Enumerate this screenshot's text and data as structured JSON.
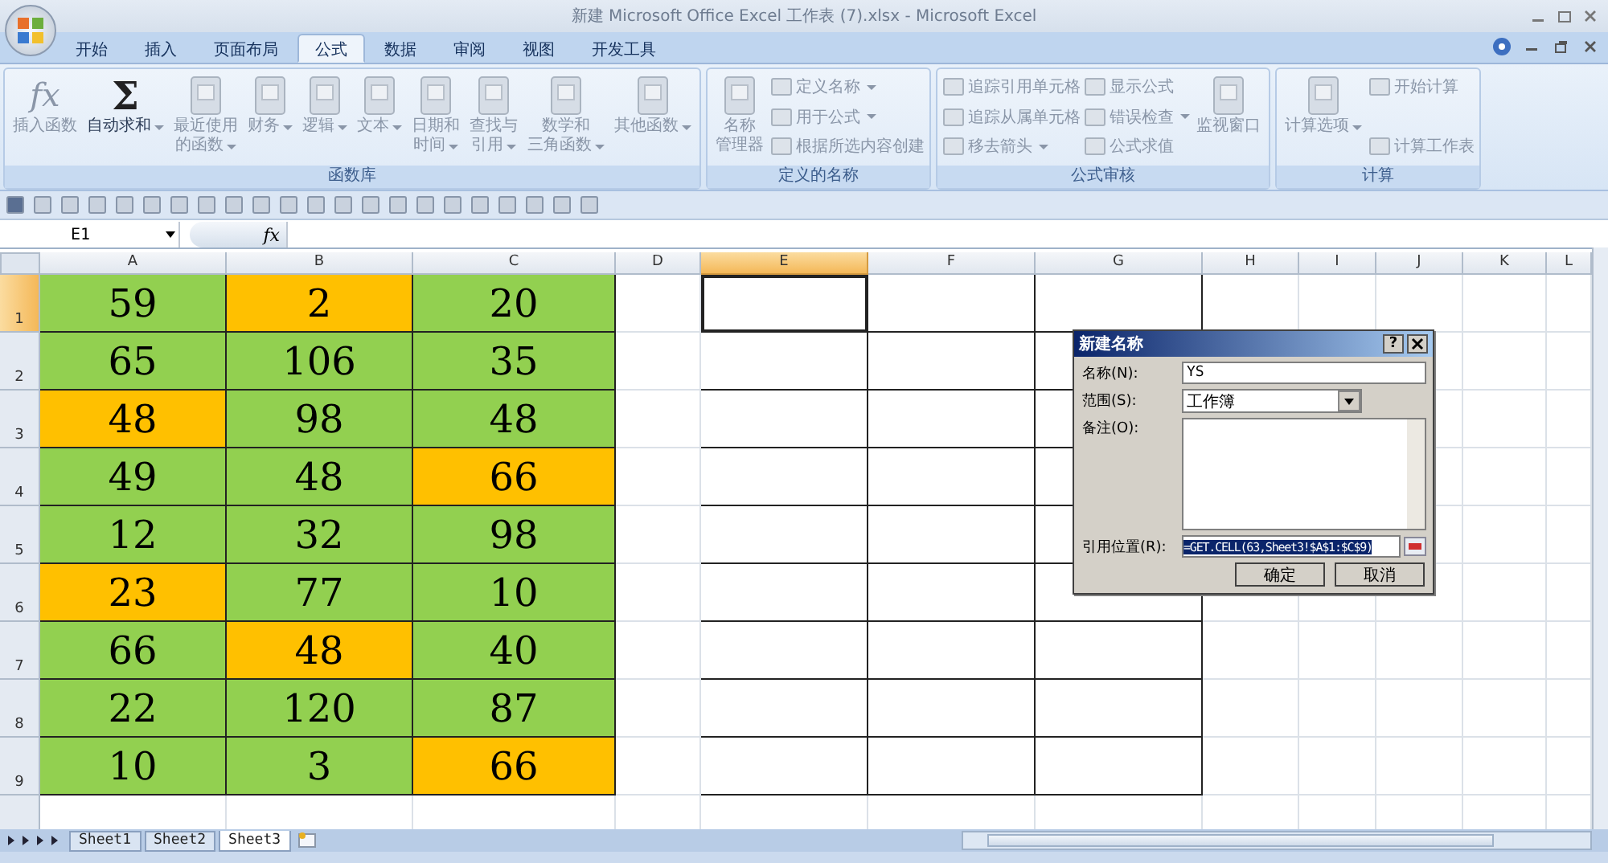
{
  "window": {
    "title": "新建 Microsoft Office Excel 工作表 (7).xlsx - Microsoft Excel"
  },
  "tabs": [
    {
      "label": "开始",
      "selected": false
    },
    {
      "label": "插入",
      "selected": false
    },
    {
      "label": "页面布局",
      "selected": false
    },
    {
      "label": "公式",
      "selected": true
    },
    {
      "label": "数据",
      "selected": false
    },
    {
      "label": "审阅",
      "selected": false
    },
    {
      "label": "视图",
      "selected": false
    },
    {
      "label": "开发工具",
      "selected": false
    }
  ],
  "ribbon": {
    "groups": [
      {
        "label": "函数库",
        "items": [
          {
            "kind": "large",
            "glyph": "fx",
            "lines": [
              "插入函数"
            ],
            "dropdown": false,
            "disabled": true
          },
          {
            "kind": "large",
            "glyph": "Σ",
            "lines": [
              "自动求和"
            ],
            "dropdown": true,
            "disabled": false
          },
          {
            "kind": "large",
            "lines": [
              "最近使用",
              "的函数"
            ],
            "dropdown": true,
            "disabled": true
          },
          {
            "kind": "large",
            "lines": [
              "财务"
            ],
            "dropdown": true,
            "disabled": true
          },
          {
            "kind": "large",
            "lines": [
              "逻辑"
            ],
            "dropdown": true,
            "disabled": true
          },
          {
            "kind": "large",
            "lines": [
              "文本"
            ],
            "dropdown": true,
            "disabled": true
          },
          {
            "kind": "large",
            "lines": [
              "日期和",
              "时间"
            ],
            "dropdown": true,
            "disabled": true
          },
          {
            "kind": "large",
            "lines": [
              "查找与",
              "引用"
            ],
            "dropdown": true,
            "disabled": true
          },
          {
            "kind": "large",
            "lines": [
              "数学和",
              "三角函数"
            ],
            "dropdown": true,
            "disabled": true
          },
          {
            "kind": "large",
            "lines": [
              "其他函数"
            ],
            "dropdown": true,
            "disabled": true
          }
        ]
      },
      {
        "label": "定义的名称",
        "items": [
          {
            "kind": "large",
            "lines": [
              "名称",
              "管理器"
            ],
            "dropdown": false,
            "disabled": true
          },
          {
            "kind": "small",
            "lines": [
              "定义名称"
            ],
            "dropdown": true,
            "disabled": true
          },
          {
            "kind": "small",
            "lines": [
              "用于公式"
            ],
            "dropdown": true,
            "disabled": true
          },
          {
            "kind": "small",
            "lines": [
              "根据所选内容创建"
            ],
            "dropdown": false,
            "disabled": true
          }
        ]
      },
      {
        "label": "公式审核",
        "items": [
          {
            "kind": "small",
            "lines": [
              "追踪引用单元格"
            ],
            "dropdown": false,
            "disabled": true
          },
          {
            "kind": "small",
            "lines": [
              "追踪从属单元格"
            ],
            "dropdown": false,
            "disabled": true
          },
          {
            "kind": "small",
            "lines": [
              "移去箭头"
            ],
            "dropdown": true,
            "disabled": true
          },
          {
            "kind": "small",
            "lines": [
              "显示公式"
            ],
            "dropdown": false,
            "disabled": true
          },
          {
            "kind": "small",
            "lines": [
              "错误检查"
            ],
            "dropdown": true,
            "disabled": true
          },
          {
            "kind": "small",
            "lines": [
              "公式求值"
            ],
            "dropdown": false,
            "disabled": true
          },
          {
            "kind": "large",
            "lines": [
              "监视窗口"
            ],
            "dropdown": false,
            "disabled": true
          }
        ]
      },
      {
        "label": "计算",
        "items": [
          {
            "kind": "large",
            "lines": [
              "计算选项"
            ],
            "dropdown": true,
            "disabled": true
          },
          {
            "kind": "small",
            "lines": [
              "开始计算"
            ],
            "dropdown": false,
            "disabled": true
          },
          {
            "kind": "small",
            "lines": [
              "计算工作表"
            ],
            "dropdown": false,
            "disabled": true
          }
        ]
      }
    ]
  },
  "formula_bar": {
    "name_box": "E1",
    "fx": "fx"
  },
  "sheet": {
    "columns": [
      {
        "label": "A",
        "selected": false
      },
      {
        "label": "B",
        "selected": false
      },
      {
        "label": "C",
        "selected": false
      },
      {
        "label": "D",
        "selected": false
      },
      {
        "label": "E",
        "selected": true
      },
      {
        "label": "F",
        "selected": false
      },
      {
        "label": "G",
        "selected": false
      },
      {
        "label": "H",
        "selected": false
      },
      {
        "label": "I",
        "selected": false
      },
      {
        "label": "J",
        "selected": false
      },
      {
        "label": "K",
        "selected": false
      },
      {
        "label": "L",
        "selected": false
      }
    ],
    "rows": [
      {
        "label": "1",
        "selected": true,
        "cells": [
          {
            "value": "59",
            "color": "#92d050"
          },
          {
            "value": "2",
            "color": "#ffc000"
          },
          {
            "value": "20",
            "color": "#92d050"
          }
        ]
      },
      {
        "label": "2",
        "selected": false,
        "cells": [
          {
            "value": "65",
            "color": "#92d050"
          },
          {
            "value": "106",
            "color": "#92d050"
          },
          {
            "value": "35",
            "color": "#92d050"
          }
        ]
      },
      {
        "label": "3",
        "selected": false,
        "cells": [
          {
            "value": "48",
            "color": "#ffc000"
          },
          {
            "value": "98",
            "color": "#92d050"
          },
          {
            "value": "48",
            "color": "#92d050"
          }
        ]
      },
      {
        "label": "4",
        "selected": false,
        "cells": [
          {
            "value": "49",
            "color": "#92d050"
          },
          {
            "value": "48",
            "color": "#92d050"
          },
          {
            "value": "66",
            "color": "#ffc000"
          }
        ]
      },
      {
        "label": "5",
        "selected": false,
        "cells": [
          {
            "value": "12",
            "color": "#92d050"
          },
          {
            "value": "32",
            "color": "#92d050"
          },
          {
            "value": "98",
            "color": "#92d050"
          }
        ]
      },
      {
        "label": "6",
        "selected": false,
        "cells": [
          {
            "value": "23",
            "color": "#ffc000"
          },
          {
            "value": "77",
            "color": "#92d050"
          },
          {
            "value": "10",
            "color": "#92d050"
          }
        ]
      },
      {
        "label": "7",
        "selected": false,
        "cells": [
          {
            "value": "66",
            "color": "#92d050"
          },
          {
            "value": "48",
            "color": "#ffc000"
          },
          {
            "value": "40",
            "color": "#92d050"
          }
        ]
      },
      {
        "label": "8",
        "selected": false,
        "cells": [
          {
            "value": "22",
            "color": "#92d050"
          },
          {
            "value": "120",
            "color": "#92d050"
          },
          {
            "value": "87",
            "color": "#92d050"
          }
        ]
      },
      {
        "label": "9",
        "selected": false,
        "cells": [
          {
            "value": "10",
            "color": "#92d050"
          },
          {
            "value": "3",
            "color": "#92d050"
          },
          {
            "value": "66",
            "color": "#ffc000"
          }
        ]
      }
    ]
  },
  "dialog": {
    "title": "新建名称",
    "help": "?",
    "name_label": "名称(N):",
    "name_value": "YS",
    "scope_label": "范围(S):",
    "scope_value": "工作簿",
    "comment_label": "备注(O):",
    "ref_label": "引用位置(R):",
    "ref_value": "=GET.CELL(63,Sheet3!$A$1:$C$9)",
    "buttons": [
      "确定",
      "取消"
    ]
  },
  "sheet_tabs": [
    {
      "label": "Sheet1",
      "selected": false
    },
    {
      "label": "Sheet2",
      "selected": false
    },
    {
      "label": "Sheet3",
      "selected": true
    }
  ]
}
